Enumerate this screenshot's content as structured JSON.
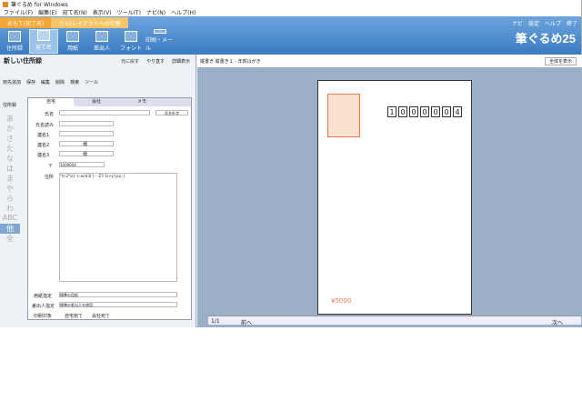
{
  "window_title": "筆ぐるめ for Windows",
  "menu": [
    "ファイル(F)",
    "編集(E)",
    "宛て名(N)",
    "表示(V)",
    "ツール(T)",
    "ナビ(N)",
    "ヘルプ(H)"
  ],
  "ribbon_tabs": [
    "おもて(宛て名)",
    "うら(レイアウトへの切替"
  ],
  "tool_buttons": [
    "住所録",
    "宛て名",
    "用紙",
    "差出人",
    "フォント",
    "印刷・メール"
  ],
  "top_links": {
    "navi": "ナビ",
    "settings": "設定",
    "help": "ヘルプ",
    "exit": "終了"
  },
  "brand": "筆ぐるめ25",
  "left": {
    "title": "新しい住所録",
    "links": [
      "元に戻す",
      "やり直す",
      "詳細表示"
    ],
    "tools": [
      "宛先追加",
      "保存",
      "編集",
      "削除",
      "検索",
      "ツール"
    ],
    "kana": [
      "あ",
      "か",
      "さ",
      "た",
      "な",
      "は",
      "ま",
      "や",
      "ら",
      "わ",
      "ABC",
      "他",
      "全"
    ],
    "kana_selected": "他",
    "address_book_label": "住所録",
    "form_tabs": [
      "自宅",
      "会社",
      "メモ"
    ],
    "fields": {
      "name": "氏名",
      "furigana": "氏名読み",
      "joint1": "連名1",
      "joint2": "連名2",
      "joint3": "連名3",
      "zip": "〒",
      "address": "住所",
      "print_name": "氏名外字"
    },
    "honorific": "様",
    "zip_value": "1000004",
    "address_value": "\"(t-2*)c[-'c-ar/$3('(・-Z7-1(>)/-Jcz,-)",
    "card_type_label": "用紙指定",
    "card_type": "標準の用紙",
    "sender_label": "差出人指定",
    "sender": "標準の差出人を使用",
    "print_target_label": "印刷対象",
    "print_opts": [
      "自宅宛て",
      "会社宛て"
    ]
  },
  "center": {
    "header": "縦書き 縦書き１ - 年賀はがき",
    "zoom": "全体を表示",
    "zip_digits": [
      "1",
      "0",
      "0",
      "0",
      "0",
      "0",
      "4"
    ],
    "lottery": "¥5000",
    "page": "1/1",
    "prev": "前へ",
    "next": "次へ"
  }
}
